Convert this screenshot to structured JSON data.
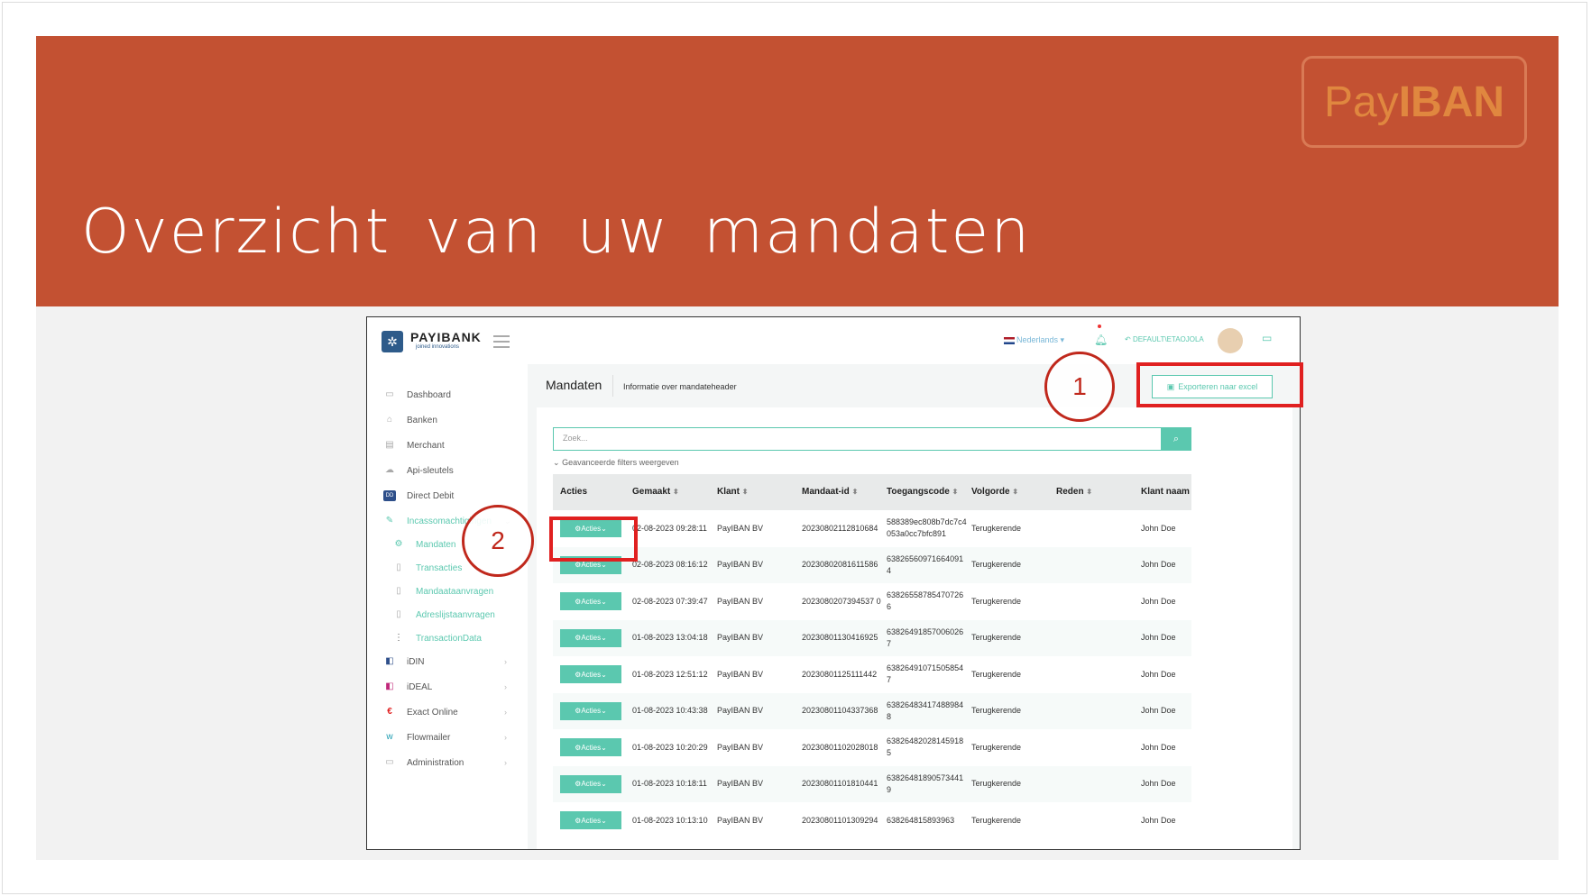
{
  "slide": {
    "title": "Overzicht van uw mandaten",
    "logo_pay": "Pay",
    "logo_iban": "IBAN",
    "banner_color": "#c35132",
    "callout_1": "1",
    "callout_2": "2"
  },
  "app": {
    "brand_name": "PAYIBANK",
    "brand_sub": "joined innovations",
    "language": "Nederlands",
    "user": "DEFAULT\\ETAOJOLA",
    "accent_color": "#5bc8af"
  },
  "sidebar": {
    "items": [
      {
        "label": "Dashboard",
        "icon": "dashboard-icon"
      },
      {
        "label": "Banken",
        "icon": "bank-icon"
      },
      {
        "label": "Merchant",
        "icon": "merchant-icon"
      },
      {
        "label": "Api-sleutels",
        "icon": "cloud-icon"
      },
      {
        "label": "Direct Debit",
        "icon": "direct-debit-icon"
      },
      {
        "label": "Incassomachtigingen",
        "icon": "edit-document-icon"
      },
      {
        "label": "Mandaten",
        "icon": "settings-icon"
      },
      {
        "label": "Transacties",
        "icon": "document-icon"
      },
      {
        "label": "Mandaataanvragen",
        "icon": "document-icon"
      },
      {
        "label": "Adreslijstaanvragen",
        "icon": "document-icon"
      },
      {
        "label": "TransactionData",
        "icon": "more-vertical-icon"
      },
      {
        "label": "iDIN",
        "icon": "idin-icon"
      },
      {
        "label": "iDEAL",
        "icon": "ideal-icon"
      },
      {
        "label": "Exact Online",
        "icon": "exact-online-icon"
      },
      {
        "label": "Flowmailer",
        "icon": "flowmailer-icon"
      },
      {
        "label": "Administration",
        "icon": "admin-icon"
      }
    ]
  },
  "main": {
    "title": "Mandaten",
    "subtitle": "Informatie over mandateheader",
    "export_label": "Exporteren naar excel",
    "search_placeholder": "Zoek...",
    "filters_toggle": "Geavanceerde filters weergeven"
  },
  "table": {
    "headers": [
      "Acties",
      "Gemaakt",
      "Klant",
      "Mandaat-id",
      "Toegangscode",
      "Volgorde",
      "Reden",
      "Klant naam"
    ],
    "action_label": "Acties",
    "rows": [
      {
        "gemaakt": "02-08-2023 09:28:11",
        "klant": "PayIBAN BV",
        "mandaat": "20230802112810684",
        "code": "588389ec808b7dc7c4053a0cc7bfc891",
        "volgorde": "Terugkerende",
        "reden": "",
        "naam": "John Doe"
      },
      {
        "gemaakt": "02-08-2023 08:16:12",
        "klant": "PayIBAN BV",
        "mandaat": "20230802081611586",
        "code": "638265609716640914",
        "volgorde": "Terugkerende",
        "reden": "",
        "naam": "John Doe"
      },
      {
        "gemaakt": "02-08-2023 07:39:47",
        "klant": "PayIBAN BV",
        "mandaat": "2023080207394537 0",
        "code": "638265587854707266",
        "volgorde": "Terugkerende",
        "reden": "",
        "naam": "John Doe"
      },
      {
        "gemaakt": "01-08-2023 13:04:18",
        "klant": "PayIBAN BV",
        "mandaat": "20230801130416925",
        "code": "638264918570060267",
        "volgorde": "Terugkerende",
        "reden": "",
        "naam": "John Doe"
      },
      {
        "gemaakt": "01-08-2023 12:51:12",
        "klant": "PayIBAN BV",
        "mandaat": "20230801125111442",
        "code": "638264910715058547",
        "volgorde": "Terugkerende",
        "reden": "",
        "naam": "John Doe"
      },
      {
        "gemaakt": "01-08-2023 10:43:38",
        "klant": "PayIBAN BV",
        "mandaat": "20230801104337368",
        "code": "638264834174889848",
        "volgorde": "Terugkerende",
        "reden": "",
        "naam": "John Doe"
      },
      {
        "gemaakt": "01-08-2023 10:20:29",
        "klant": "PayIBAN BV",
        "mandaat": "20230801102028018",
        "code": "638264820281459185",
        "volgorde": "Terugkerende",
        "reden": "",
        "naam": "John Doe"
      },
      {
        "gemaakt": "01-08-2023 10:18:11",
        "klant": "PayIBAN BV",
        "mandaat": "20230801101810441",
        "code": "638264818905734419",
        "volgorde": "Terugkerende",
        "reden": "",
        "naam": "John Doe"
      },
      {
        "gemaakt": "01-08-2023 10:13:10",
        "klant": "PayIBAN BV",
        "mandaat": "20230801101309294",
        "code": "638264815893963",
        "volgorde": "Terugkerende",
        "reden": "",
        "naam": "John Doe"
      }
    ]
  }
}
